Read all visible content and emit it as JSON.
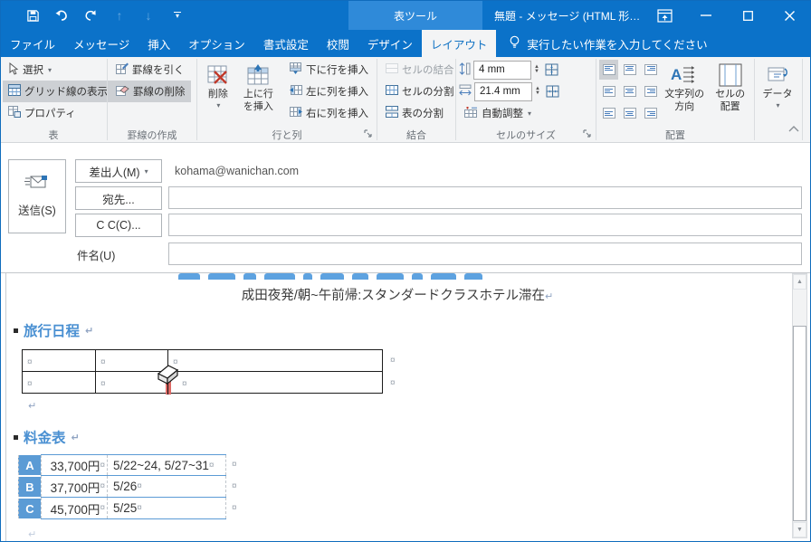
{
  "titlebar": {
    "contextual_header": "表ツール",
    "title": "無題 - メッセージ (HTML 形…"
  },
  "tabs": {
    "items": [
      {
        "label": "ファイル"
      },
      {
        "label": "メッセージ"
      },
      {
        "label": "挿入"
      },
      {
        "label": "オプション"
      },
      {
        "label": "書式設定"
      },
      {
        "label": "校閲"
      },
      {
        "label": "デザイン"
      },
      {
        "label": "レイアウト"
      }
    ],
    "tell_me": "実行したい作業を入力してください"
  },
  "ribbon": {
    "table_group": {
      "label": "表",
      "select": "選択",
      "gridlines": "グリッド線の表示",
      "properties": "プロパティ"
    },
    "borders_group": {
      "label": "罫線の作成",
      "draw": "罫線を引く",
      "eraser": "罫線の削除"
    },
    "rows_group": {
      "label": "行と列",
      "delete": "削除",
      "insert_above": "上に行を挿入",
      "insert_below": "下に行を挿入",
      "insert_left": "左に列を挿入",
      "insert_right": "右に列を挿入"
    },
    "merge_group": {
      "label": "結合",
      "merge": "セルの結合",
      "split": "セルの分割",
      "split_table": "表の分割"
    },
    "size_group": {
      "label": "セルのサイズ",
      "height_value": "4 mm",
      "width_value": "21.4 mm",
      "autofit": "自動調整"
    },
    "align_group": {
      "label": "配置",
      "text_direction": "文字列の方向",
      "cell_margins": "セルの配置"
    },
    "data_group": {
      "button": "データ"
    }
  },
  "compose": {
    "send": "送信(S)",
    "from_button": "差出人(M)",
    "from_value": "kohama@wanichan.com",
    "to_button": "宛先...",
    "cc_button": "C C(C)...",
    "subject_label": "件名(U)"
  },
  "body": {
    "intro_line": "成田夜発/朝~午前帰:スタンダードクラスホテル滞在",
    "heading_itinerary": "旅行日程",
    "heading_price": "料金表",
    "price_table": {
      "rows": [
        {
          "label": "A",
          "price": "33,700円",
          "dates": "5/22~24, 5/27~31"
        },
        {
          "label": "B",
          "price": "37,700円",
          "dates": "5/26"
        },
        {
          "label": "C",
          "price": "45,700円",
          "dates": "5/25"
        }
      ]
    }
  },
  "icons": {
    "dropdown": "▾",
    "cell_marker": "¤",
    "para_marker": "↵",
    "spin_up": "▲",
    "spin_down": "▼"
  },
  "colors": {
    "titlebar_blue": "#0b72c9",
    "contextual_blue": "#2f8ad9",
    "accent_table_blue": "#5b9bd5",
    "heading_blue": "#4a90d2",
    "eraser_highlight_red": "#dd6a66"
  }
}
